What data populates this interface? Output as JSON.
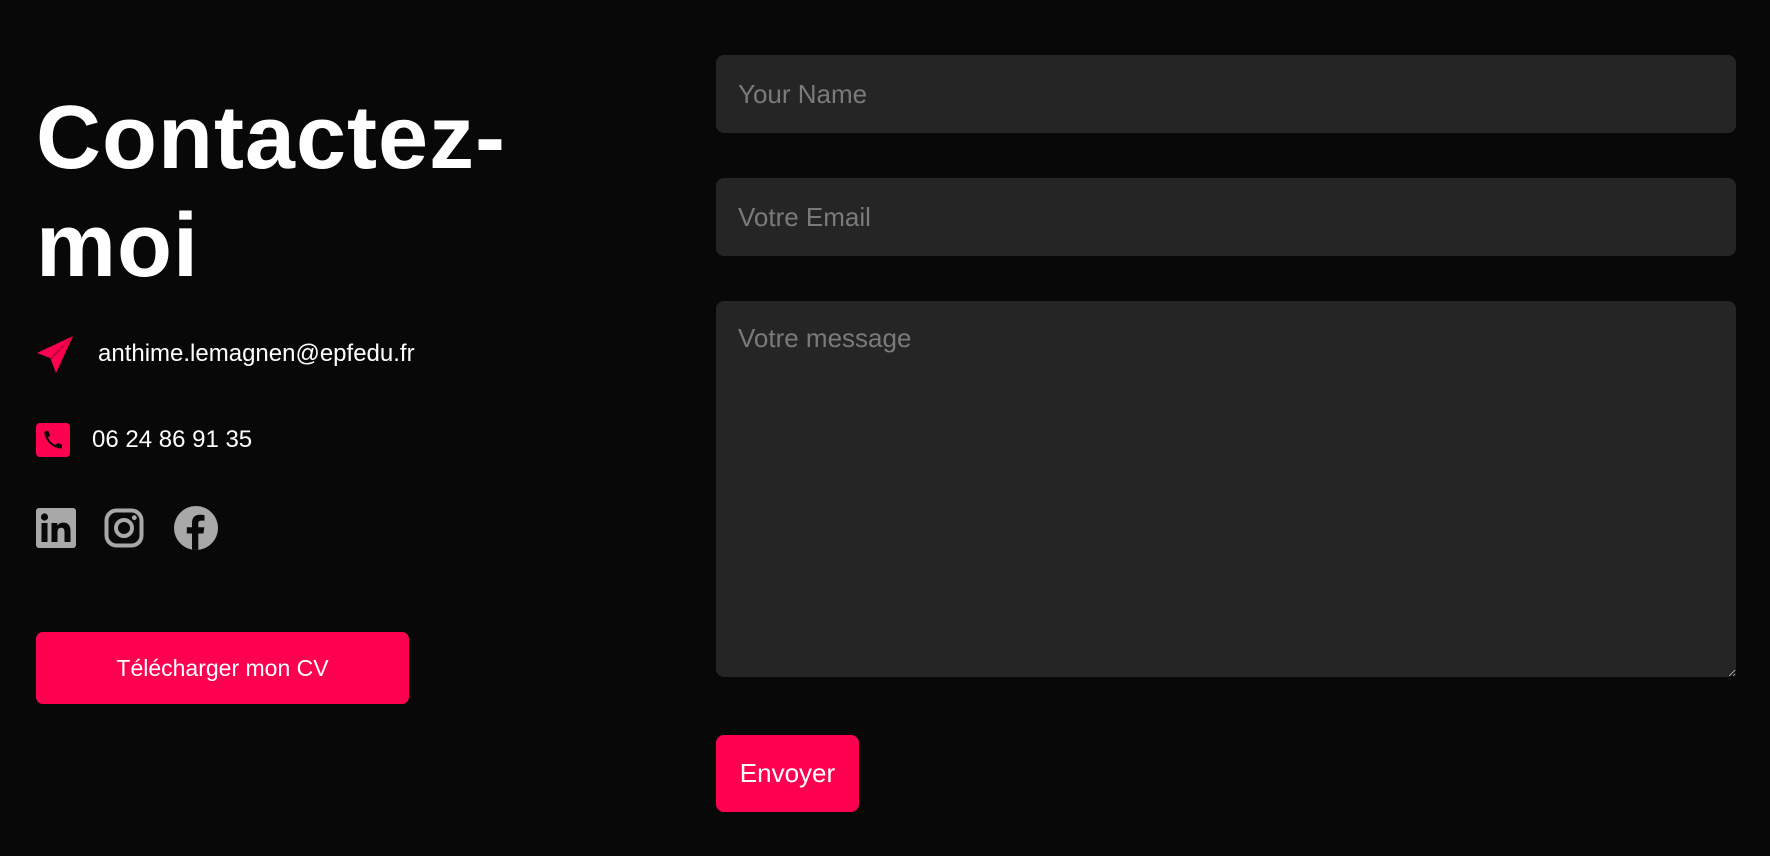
{
  "contact": {
    "title": "Contactez-moi",
    "email": "anthime.lemagnen@epfedu.fr",
    "phone": "06 24 86 91 35",
    "cv_button_label": "Télécharger mon CV",
    "icons": {
      "email": "paper-plane-icon",
      "phone": "phone-square-icon"
    },
    "socials": [
      {
        "name": "linkedin",
        "icon": "linkedin-icon"
      },
      {
        "name": "instagram",
        "icon": "instagram-icon"
      },
      {
        "name": "facebook",
        "icon": "facebook-icon"
      }
    ]
  },
  "form": {
    "name_placeholder": "Your Name",
    "email_placeholder": "Votre Email",
    "message_placeholder": "Votre message",
    "submit_label": "Envoyer"
  },
  "colors": {
    "background": "#080808",
    "accent": "#ff0050",
    "field_background": "#252525",
    "placeholder": "#7a7a7a",
    "social_icons": "#a8a8a8",
    "text": "#ffffff"
  }
}
